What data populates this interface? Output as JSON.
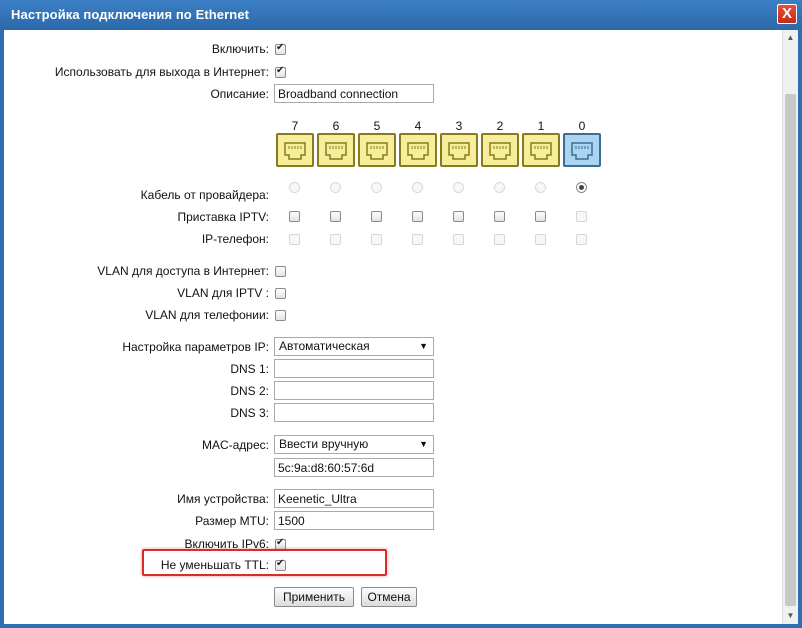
{
  "window": {
    "title": "Настройка подключения по Ethernet",
    "close_label": "X"
  },
  "form": {
    "enable_label": "Включить:",
    "internet_label": "Использовать для выхода в Интернет:",
    "description_label": "Описание:",
    "description_value": "Broadband connection",
    "ports": [
      "7",
      "6",
      "5",
      "4",
      "3",
      "2",
      "1",
      "0"
    ],
    "provider_cable_label": "Кабель от провайдера:",
    "iptv_label": "Приставка IPTV:",
    "ip_phone_label": "IP-телефон:",
    "vlan_internet_label": "VLAN для доступа в Интернет:",
    "vlan_iptv_label": "VLAN для IPTV :",
    "vlan_phone_label": "VLAN для телефонии:",
    "ip_settings_label": "Настройка параметров IP:",
    "ip_settings_value": "Автоматическая",
    "dns1_label": "DNS 1:",
    "dns2_label": "DNS 2:",
    "dns3_label": "DNS 3:",
    "mac_label": "MAC-адрес:",
    "mac_mode_value": "Ввести вручную",
    "mac_value": "5c:9a:d8:60:57:6d",
    "device_name_label": "Имя устройства:",
    "device_name_value": "Keenetic_Ultra",
    "mtu_label": "Размер MTU:",
    "mtu_value": "1500",
    "ipv6_label": "Включить IPv6:",
    "ttl_label": "Не уменьшать TTL:",
    "apply_label": "Применить",
    "cancel_label": "Отмена"
  },
  "colors": {
    "accent": "#2d6fb2",
    "highlight": "#d82c2c",
    "port_yellow": "#f6ee9a",
    "port_blue": "#aad4ef"
  }
}
